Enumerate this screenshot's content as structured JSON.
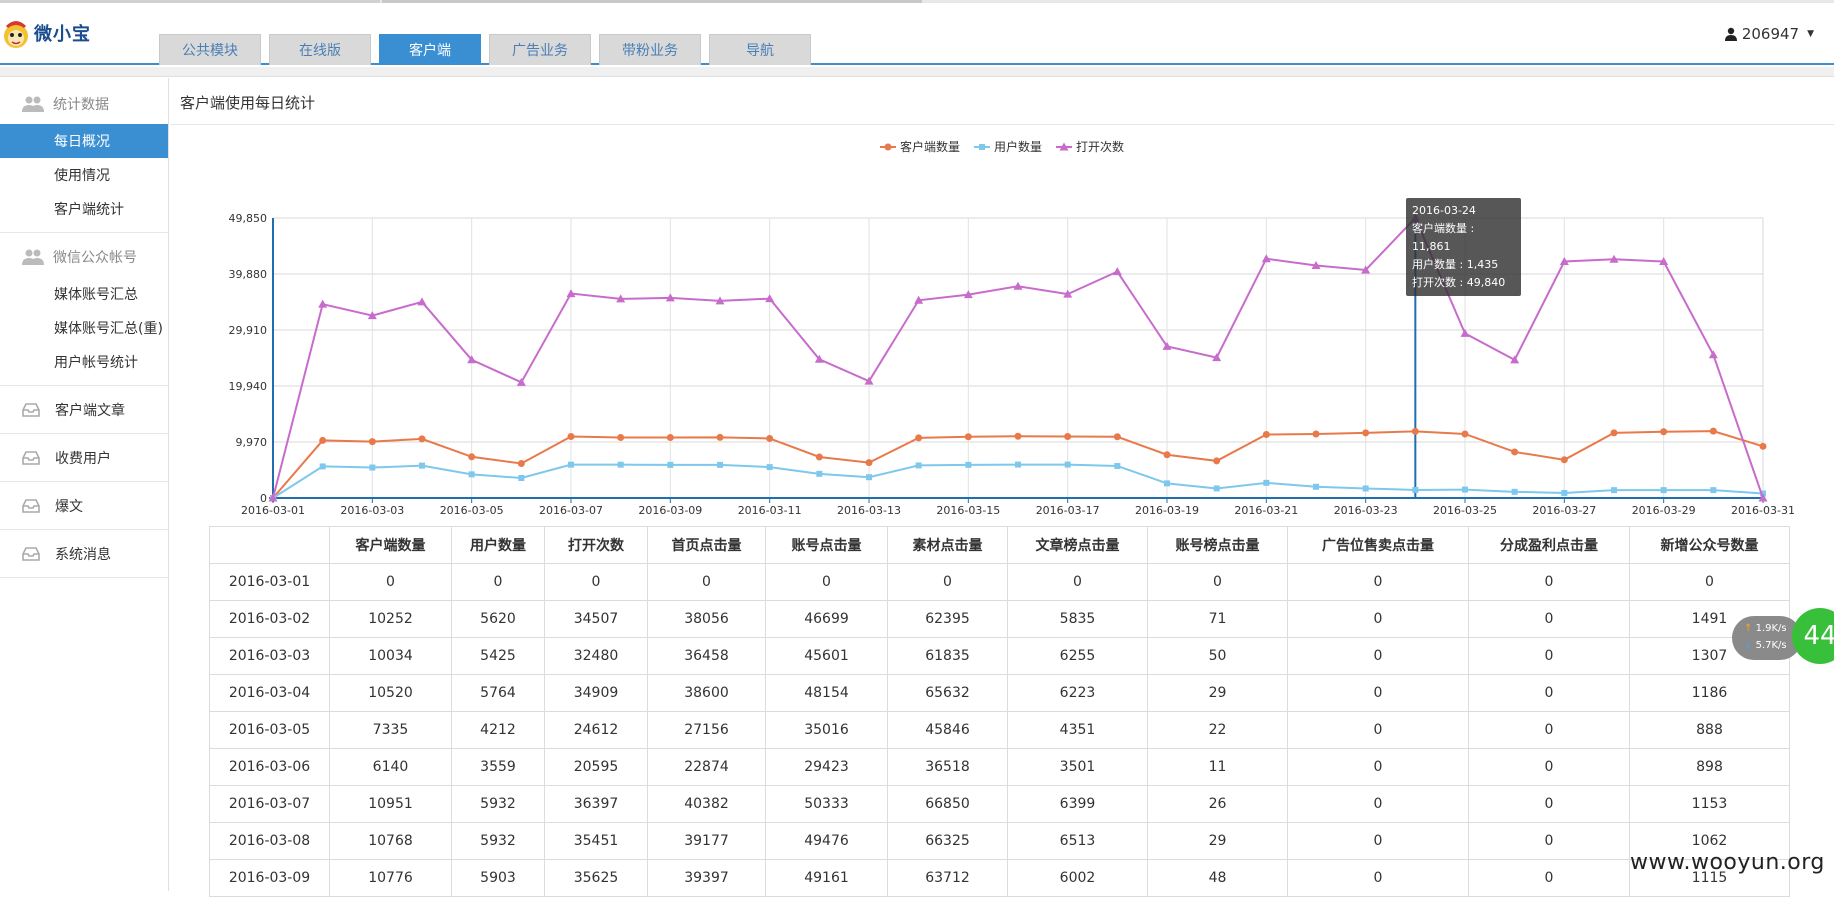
{
  "app": {
    "logo_text": "微小宝"
  },
  "tabs": [
    {
      "label": "公共模块",
      "active": false
    },
    {
      "label": "在线版",
      "active": false
    },
    {
      "label": "客户端",
      "active": true
    },
    {
      "label": "广告业务",
      "active": false
    },
    {
      "label": "带粉业务",
      "active": false
    },
    {
      "label": "导航",
      "active": false
    }
  ],
  "user": {
    "name": "206947"
  },
  "sidebar": {
    "group1": {
      "label": "统计数据",
      "items": [
        {
          "label": "每日概况",
          "active": true
        },
        {
          "label": "使用情况"
        },
        {
          "label": "客户端统计"
        }
      ]
    },
    "group2": {
      "label": "微信公众帐号",
      "items": [
        {
          "label": "媒体账号汇总"
        },
        {
          "label": "媒体账号汇总(重)"
        },
        {
          "label": "用户帐号统计"
        }
      ]
    },
    "links": [
      {
        "label": "客户端文章"
      },
      {
        "label": "收费用户"
      },
      {
        "label": "爆文"
      },
      {
        "label": "系统消息"
      }
    ]
  },
  "page": {
    "title": "客户端使用每日统计"
  },
  "chart_data": {
    "type": "line",
    "legend": [
      "客户端数量",
      "用户数量",
      "打开次数"
    ],
    "legend_position": "top",
    "ylim": [
      0,
      49850
    ],
    "yticks": [
      "49,850",
      "39,880",
      "29,910",
      "19,940",
      "9,970",
      "0"
    ],
    "x": [
      "2016-03-01",
      "2016-03-02",
      "2016-03-03",
      "2016-03-04",
      "2016-03-05",
      "2016-03-06",
      "2016-03-07",
      "2016-03-08",
      "2016-03-09",
      "2016-03-10",
      "2016-03-11",
      "2016-03-12",
      "2016-03-13",
      "2016-03-14",
      "2016-03-15",
      "2016-03-16",
      "2016-03-17",
      "2016-03-18",
      "2016-03-19",
      "2016-03-20",
      "2016-03-21",
      "2016-03-22",
      "2016-03-23",
      "2016-03-24",
      "2016-03-25",
      "2016-03-26",
      "2016-03-27",
      "2016-03-28",
      "2016-03-29",
      "2016-03-30",
      "2016-03-31"
    ],
    "xtick_labels": [
      "2016-03-01",
      "2016-03-03",
      "2016-03-05",
      "2016-03-07",
      "2016-03-09",
      "2016-03-11",
      "2016-03-13",
      "2016-03-15",
      "2016-03-17",
      "2016-03-19",
      "2016-03-21",
      "2016-03-23",
      "2016-03-25",
      "2016-03-27",
      "2016-03-29",
      "2016-03-31"
    ],
    "series": [
      {
        "name": "客户端数量",
        "color": "#e8794a",
        "marker": "circle",
        "values": [
          0,
          10252,
          10034,
          10520,
          7335,
          6140,
          10951,
          10768,
          10776,
          10800,
          10600,
          7300,
          6300,
          10700,
          10900,
          11000,
          10950,
          10900,
          7700,
          6600,
          11300,
          11400,
          11600,
          11861,
          11400,
          8200,
          6800,
          11600,
          11800,
          11900,
          9200
        ]
      },
      {
        "name": "用户数量",
        "color": "#7dc8ec",
        "marker": "square",
        "values": [
          0,
          5620,
          5425,
          5764,
          4212,
          3559,
          5932,
          5932,
          5903,
          5900,
          5500,
          4300,
          3700,
          5800,
          5900,
          5950,
          5950,
          5700,
          2600,
          1700,
          2700,
          2000,
          1700,
          1435,
          1500,
          1100,
          900,
          1400,
          1400,
          1400,
          800
        ]
      },
      {
        "name": "打开次数",
        "color": "#c86ccc",
        "marker": "triangle",
        "values": [
          0,
          34507,
          32480,
          34909,
          24612,
          20595,
          36397,
          35451,
          35625,
          35100,
          35500,
          24700,
          20800,
          35200,
          36200,
          37700,
          36300,
          40300,
          27000,
          25000,
          42600,
          41400,
          40600,
          49840,
          29300,
          24600,
          42100,
          42500,
          42100,
          25500,
          0
        ]
      }
    ],
    "tooltip": {
      "date": "2016-03-24",
      "lines": [
        "客户端数量 : 11,861",
        "用户数量 : 1,435",
        "打开次数 : 49,840"
      ]
    }
  },
  "table": {
    "headers": [
      "",
      "客户端数量",
      "用户数量",
      "打开次数",
      "首页点击量",
      "账号点击量",
      "素材点击量",
      "文章榜点击量",
      "账号榜点击量",
      "广告位售卖点击量",
      "分成盈利点击量",
      "新增公众号数量"
    ],
    "rows": [
      [
        "2016-03-01",
        "0",
        "0",
        "0",
        "0",
        "0",
        "0",
        "0",
        "0",
        "0",
        "0",
        "0"
      ],
      [
        "2016-03-02",
        "10252",
        "5620",
        "34507",
        "38056",
        "46699",
        "62395",
        "5835",
        "71",
        "0",
        "0",
        "1491"
      ],
      [
        "2016-03-03",
        "10034",
        "5425",
        "32480",
        "36458",
        "45601",
        "61835",
        "6255",
        "50",
        "0",
        "0",
        "1307"
      ],
      [
        "2016-03-04",
        "10520",
        "5764",
        "34909",
        "38600",
        "48154",
        "65632",
        "6223",
        "29",
        "0",
        "0",
        "1186"
      ],
      [
        "2016-03-05",
        "7335",
        "4212",
        "24612",
        "27156",
        "35016",
        "45846",
        "4351",
        "22",
        "0",
        "0",
        "888"
      ],
      [
        "2016-03-06",
        "6140",
        "3559",
        "20595",
        "22874",
        "29423",
        "36518",
        "3501",
        "11",
        "0",
        "0",
        "898"
      ],
      [
        "2016-03-07",
        "10951",
        "5932",
        "36397",
        "40382",
        "50333",
        "66850",
        "6399",
        "26",
        "0",
        "0",
        "1153"
      ],
      [
        "2016-03-08",
        "10768",
        "5932",
        "35451",
        "39177",
        "49476",
        "66325",
        "6513",
        "29",
        "0",
        "0",
        "1062"
      ],
      [
        "2016-03-09",
        "10776",
        "5903",
        "35625",
        "39397",
        "49161",
        "63712",
        "6002",
        "48",
        "0",
        "0",
        "1115"
      ]
    ]
  },
  "speed": {
    "up": "1.9K/s",
    "down": "5.7K/s",
    "badge": "44"
  },
  "watermark": "www.wooyun.org"
}
